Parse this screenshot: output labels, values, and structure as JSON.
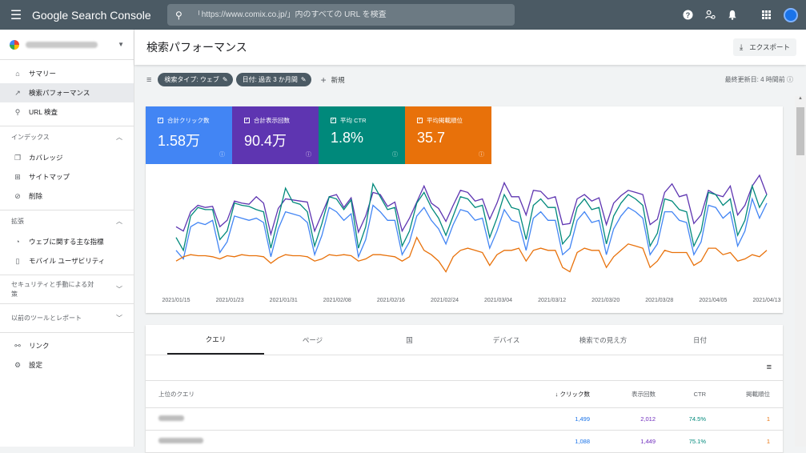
{
  "topbar": {
    "brand": "Google Search Console",
    "search_placeholder": "「https://www.comix.co.jp/」内のすべての URL を検査"
  },
  "sidebar": {
    "items_top": [
      {
        "icon": "home-icon",
        "label": "サマリー"
      },
      {
        "icon": "trending-up-icon",
        "label": "検索パフォーマンス",
        "active": true
      },
      {
        "icon": "search-icon",
        "label": "URL 検査"
      }
    ],
    "index_section": "インデックス",
    "index_items": [
      {
        "icon": "coverage-icon",
        "label": "カバレッジ"
      },
      {
        "icon": "sitemap-icon",
        "label": "サイトマップ"
      },
      {
        "icon": "removal-icon",
        "label": "削除"
      }
    ],
    "enhance_section": "拡張",
    "enhance_items": [
      {
        "icon": "gauge-icon",
        "label": "ウェブに関する主な指標"
      },
      {
        "icon": "phone-icon",
        "label": "モバイル ユーザビリティ"
      }
    ],
    "security_section": "セキュリティと手動による対策",
    "legacy_section": "以前のツールとレポート",
    "bottom_items": [
      {
        "icon": "links-icon",
        "label": "リンク"
      },
      {
        "icon": "settings-icon",
        "label": "設定"
      }
    ]
  },
  "header": {
    "title": "検索パフォーマンス",
    "export_label": "エクスポート"
  },
  "filters": {
    "chip1": "検索タイプ: ウェブ",
    "chip2": "日付: 過去 3 か月間",
    "new_label": "新規",
    "updated": "最終更新日: 4 時間前"
  },
  "metrics": [
    {
      "label": "合計クリック数",
      "value": "1.58万",
      "color": "#4285f4"
    },
    {
      "label": "合計表示回数",
      "value": "90.4万",
      "color": "#5e35b1"
    },
    {
      "label": "平均 CTR",
      "value": "1.8%",
      "color": "#00897b"
    },
    {
      "label": "平均掲載順位",
      "value": "35.7",
      "color": "#e8710a"
    }
  ],
  "chart_data": {
    "type": "line",
    "x_ticks": [
      "2021/01/15",
      "2021/01/23",
      "2021/01/31",
      "2021/02/08",
      "2021/02/16",
      "2021/02/24",
      "2021/03/04",
      "2021/03/12",
      "2021/03/20",
      "2021/03/28",
      "2021/04/05",
      "2021/04/13"
    ],
    "series": [
      {
        "name": "合計表示回数",
        "color": "#5e35b1",
        "values": [
          0.52,
          0.48,
          0.66,
          0.72,
          0.7,
          0.71,
          0.52,
          0.58,
          0.76,
          0.74,
          0.73,
          0.8,
          0.74,
          0.45,
          0.69,
          0.78,
          0.77,
          0.76,
          0.75,
          0.48,
          0.64,
          0.8,
          0.82,
          0.7,
          0.79,
          0.47,
          0.62,
          0.84,
          0.82,
          0.71,
          0.75,
          0.48,
          0.6,
          0.75,
          0.9,
          0.74,
          0.69,
          0.57,
          0.72,
          0.86,
          0.84,
          0.76,
          0.78,
          0.59,
          0.74,
          0.93,
          0.8,
          0.8,
          0.63,
          0.86,
          0.85,
          0.78,
          0.8,
          0.54,
          0.55,
          0.78,
          0.82,
          0.76,
          0.79,
          0.54,
          0.74,
          0.81,
          0.86,
          0.84,
          0.82,
          0.54,
          0.59,
          0.84,
          0.92,
          0.8,
          0.82,
          0.55,
          0.63,
          0.86,
          0.82,
          0.8,
          0.9,
          0.63,
          0.72,
          0.9,
          1.0,
          0.82
        ]
      },
      {
        "name": "平均 CTR",
        "color": "#00897b",
        "values": [
          0.42,
          0.3,
          0.62,
          0.7,
          0.68,
          0.68,
          0.4,
          0.48,
          0.74,
          0.72,
          0.71,
          0.68,
          0.66,
          0.32,
          0.6,
          0.88,
          0.75,
          0.73,
          0.66,
          0.34,
          0.55,
          0.8,
          0.78,
          0.68,
          0.77,
          0.32,
          0.52,
          0.92,
          0.8,
          0.68,
          0.7,
          0.34,
          0.48,
          0.74,
          0.84,
          0.7,
          0.6,
          0.44,
          0.62,
          0.8,
          0.78,
          0.7,
          0.72,
          0.42,
          0.6,
          0.82,
          0.7,
          0.68,
          0.4,
          0.72,
          0.78,
          0.7,
          0.7,
          0.36,
          0.44,
          0.7,
          0.78,
          0.68,
          0.7,
          0.36,
          0.62,
          0.74,
          0.82,
          0.78,
          0.72,
          0.34,
          0.46,
          0.78,
          0.76,
          0.68,
          0.66,
          0.34,
          0.48,
          0.84,
          0.82,
          0.72,
          0.78,
          0.44,
          0.58,
          0.9,
          0.7,
          0.82
        ]
      },
      {
        "name": "合計クリック数",
        "color": "#4285f4",
        "values": [
          0.3,
          0.22,
          0.52,
          0.56,
          0.54,
          0.58,
          0.28,
          0.38,
          0.62,
          0.6,
          0.58,
          0.6,
          0.56,
          0.24,
          0.5,
          0.66,
          0.64,
          0.62,
          0.56,
          0.26,
          0.44,
          0.7,
          0.66,
          0.58,
          0.64,
          0.24,
          0.4,
          0.72,
          0.66,
          0.58,
          0.58,
          0.26,
          0.38,
          0.62,
          0.7,
          0.58,
          0.5,
          0.36,
          0.54,
          0.68,
          0.66,
          0.58,
          0.6,
          0.32,
          0.48,
          0.68,
          0.58,
          0.56,
          0.3,
          0.6,
          0.66,
          0.58,
          0.58,
          0.26,
          0.32,
          0.58,
          0.66,
          0.56,
          0.58,
          0.26,
          0.5,
          0.62,
          0.7,
          0.66,
          0.6,
          0.26,
          0.36,
          0.66,
          0.66,
          0.58,
          0.56,
          0.26,
          0.38,
          0.72,
          0.7,
          0.6,
          0.66,
          0.34,
          0.48,
          0.78,
          0.6,
          0.74
        ]
      },
      {
        "name": "平均掲載順位",
        "color": "#e8710a",
        "values": [
          0.2,
          0.24,
          0.26,
          0.25,
          0.25,
          0.24,
          0.22,
          0.25,
          0.24,
          0.26,
          0.25,
          0.25,
          0.24,
          0.18,
          0.23,
          0.26,
          0.25,
          0.25,
          0.24,
          0.2,
          0.22,
          0.26,
          0.25,
          0.26,
          0.25,
          0.2,
          0.22,
          0.26,
          0.26,
          0.25,
          0.24,
          0.2,
          0.24,
          0.42,
          0.3,
          0.26,
          0.2,
          0.1,
          0.24,
          0.3,
          0.32,
          0.3,
          0.28,
          0.16,
          0.26,
          0.3,
          0.3,
          0.32,
          0.2,
          0.3,
          0.32,
          0.3,
          0.3,
          0.14,
          0.1,
          0.28,
          0.32,
          0.3,
          0.3,
          0.14,
          0.24,
          0.3,
          0.36,
          0.34,
          0.32,
          0.14,
          0.2,
          0.3,
          0.28,
          0.28,
          0.28,
          0.16,
          0.2,
          0.32,
          0.32,
          0.26,
          0.28,
          0.2,
          0.22,
          0.26,
          0.24,
          0.3
        ]
      }
    ]
  },
  "table": {
    "tabs": [
      "クエリ",
      "ページ",
      "国",
      "デバイス",
      "検索での見え方",
      "日付"
    ],
    "headers": {
      "query": "上位のクエリ",
      "clicks": "クリック数",
      "impressions": "表示回数",
      "ctr": "CTR",
      "position": "掲載順位"
    },
    "rows": [
      {
        "clicks": "1,499",
        "impressions": "2,012",
        "ctr": "74.5%",
        "position": "1"
      },
      {
        "clicks": "1,088",
        "impressions": "1,449",
        "ctr": "75.1%",
        "position": "1"
      }
    ]
  }
}
